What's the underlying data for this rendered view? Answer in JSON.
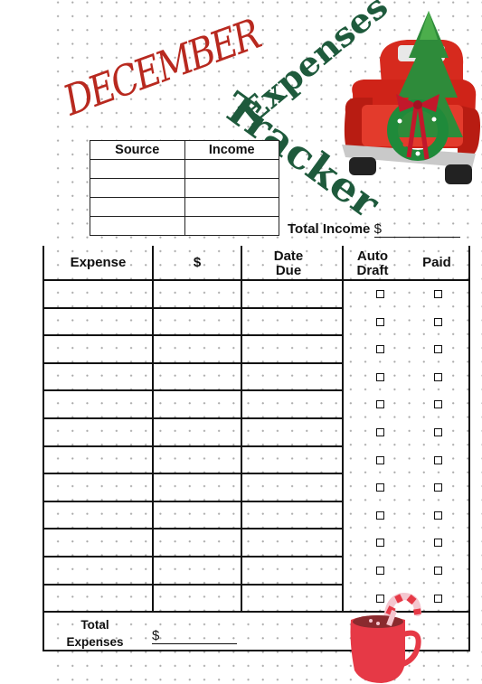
{
  "title": {
    "month": "DECEMBER",
    "word1": "Expenses",
    "word2": "Tracker"
  },
  "colors": {
    "month_red": "#b8291f",
    "title_green": "#1e5a3c",
    "mug_red": "#e63946",
    "grid_dot": "#a9a9a9"
  },
  "income_table": {
    "headers": [
      "Source",
      "Income"
    ],
    "rows": [
      [
        "",
        ""
      ],
      [
        "",
        ""
      ],
      [
        "",
        ""
      ],
      [
        "",
        ""
      ]
    ]
  },
  "total_income": {
    "label": "Total Income",
    "currency": "$",
    "value": ""
  },
  "expense_table": {
    "headers": {
      "expense": "Expense",
      "amount": "$",
      "date_due": "Date Due",
      "auto_draft": "Auto Draft",
      "paid": "Paid"
    },
    "rows": [
      {
        "expense": "",
        "amount": "",
        "date_due": "",
        "auto_draft": false,
        "paid": false
      },
      {
        "expense": "",
        "amount": "",
        "date_due": "",
        "auto_draft": false,
        "paid": false
      },
      {
        "expense": "",
        "amount": "",
        "date_due": "",
        "auto_draft": false,
        "paid": false
      },
      {
        "expense": "",
        "amount": "",
        "date_due": "",
        "auto_draft": false,
        "paid": false
      },
      {
        "expense": "",
        "amount": "",
        "date_due": "",
        "auto_draft": false,
        "paid": false
      },
      {
        "expense": "",
        "amount": "",
        "date_due": "",
        "auto_draft": false,
        "paid": false
      },
      {
        "expense": "",
        "amount": "",
        "date_due": "",
        "auto_draft": false,
        "paid": false
      },
      {
        "expense": "",
        "amount": "",
        "date_due": "",
        "auto_draft": false,
        "paid": false
      },
      {
        "expense": "",
        "amount": "",
        "date_due": "",
        "auto_draft": false,
        "paid": false
      },
      {
        "expense": "",
        "amount": "",
        "date_due": "",
        "auto_draft": false,
        "paid": false
      },
      {
        "expense": "",
        "amount": "",
        "date_due": "",
        "auto_draft": false,
        "paid": false
      },
      {
        "expense": "",
        "amount": "",
        "date_due": "",
        "auto_draft": false,
        "paid": false
      }
    ],
    "total": {
      "label": "Total Expenses",
      "currency": "$",
      "value": ""
    }
  },
  "illustrations": {
    "truck": "red-truck-with-christmas-tree-icon",
    "mug": "hot-cocoa-mug-with-candy-cane-icon"
  }
}
